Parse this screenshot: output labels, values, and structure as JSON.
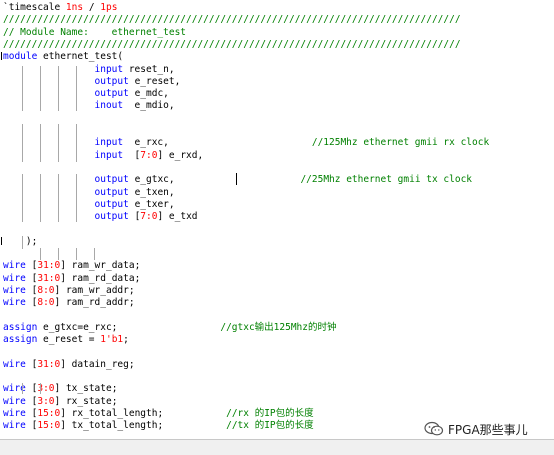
{
  "editor": {
    "lines": [
      [
        {
          "t": "`timescale ",
          "c": "pl"
        },
        {
          "t": "1ns",
          "c": "num"
        },
        {
          "t": " / ",
          "c": "pl"
        },
        {
          "t": "1ps",
          "c": "num"
        }
      ],
      [
        {
          "t": "////////////////////////////////////////////////////////////////////////////////",
          "c": "cm"
        }
      ],
      [
        {
          "t": "// Module Name:    ethernet_test",
          "c": "cm"
        }
      ],
      [
        {
          "t": "////////////////////////////////////////////////////////////////////////////////",
          "c": "cm"
        }
      ],
      [
        {
          "t": "module",
          "c": "kw"
        },
        {
          "t": " ethernet_test(",
          "c": "pl"
        }
      ],
      [
        {
          "t": "                input",
          "c": "kw"
        },
        {
          "t": " reset_n,",
          "c": "pl"
        }
      ],
      [
        {
          "t": "                output",
          "c": "kw"
        },
        {
          "t": " e_reset,",
          "c": "pl"
        }
      ],
      [
        {
          "t": "                output",
          "c": "kw"
        },
        {
          "t": " e_mdc,",
          "c": "pl"
        }
      ],
      [
        {
          "t": "                inout",
          "c": "kw"
        },
        {
          "t": "  e_mdio,",
          "c": "pl"
        }
      ],
      [],
      [],
      [
        {
          "t": "                input",
          "c": "kw"
        },
        {
          "t": "  e_rxc,                         ",
          "c": "pl"
        },
        {
          "t": "//125Mhz ethernet gmii rx clock",
          "c": "cm"
        }
      ],
      [
        {
          "t": "                input",
          "c": "kw"
        },
        {
          "t": "  [",
          "c": "pl"
        },
        {
          "t": "7:0",
          "c": "num"
        },
        {
          "t": "] e_rxd,",
          "c": "pl"
        }
      ],
      [],
      [
        {
          "t": "                output",
          "c": "kw"
        },
        {
          "t": " e_gtxc,                      ",
          "c": "pl"
        },
        {
          "t": "//25Mhz ethernet gmii tx clock",
          "c": "cm"
        }
      ],
      [
        {
          "t": "                output",
          "c": "kw"
        },
        {
          "t": " e_txen,",
          "c": "pl"
        }
      ],
      [
        {
          "t": "                output",
          "c": "kw"
        },
        {
          "t": " e_txer,",
          "c": "pl"
        }
      ],
      [
        {
          "t": "                output",
          "c": "kw"
        },
        {
          "t": " [",
          "c": "pl"
        },
        {
          "t": "7:0",
          "c": "num"
        },
        {
          "t": "] e_txd",
          "c": "pl"
        }
      ],
      [],
      [
        {
          "t": "    );",
          "c": "pl"
        }
      ],
      [],
      [
        {
          "t": "wire",
          "c": "kw"
        },
        {
          "t": " [",
          "c": "pl"
        },
        {
          "t": "31:0",
          "c": "num"
        },
        {
          "t": "] ram_wr_data;",
          "c": "pl"
        }
      ],
      [
        {
          "t": "wire",
          "c": "kw"
        },
        {
          "t": " [",
          "c": "pl"
        },
        {
          "t": "31:0",
          "c": "num"
        },
        {
          "t": "] ram_rd_data;",
          "c": "pl"
        }
      ],
      [
        {
          "t": "wire",
          "c": "kw"
        },
        {
          "t": " [",
          "c": "pl"
        },
        {
          "t": "8:0",
          "c": "num"
        },
        {
          "t": "] ram_wr_addr;",
          "c": "pl"
        }
      ],
      [
        {
          "t": "wire",
          "c": "kw"
        },
        {
          "t": " [",
          "c": "pl"
        },
        {
          "t": "8:0",
          "c": "num"
        },
        {
          "t": "] ram_rd_addr;",
          "c": "pl"
        }
      ],
      [],
      [
        {
          "t": "assign",
          "c": "kw"
        },
        {
          "t": " e_gtxc=e_rxc;                  ",
          "c": "pl"
        },
        {
          "t": "//gtxc输出125Mhz的时钟",
          "c": "cm"
        }
      ],
      [
        {
          "t": "assign",
          "c": "kw"
        },
        {
          "t": " e_reset = ",
          "c": "pl"
        },
        {
          "t": "1'b1",
          "c": "num"
        },
        {
          "t": ";",
          "c": "pl"
        }
      ],
      [],
      [
        {
          "t": "wire",
          "c": "kw"
        },
        {
          "t": " [",
          "c": "pl"
        },
        {
          "t": "31:0",
          "c": "num"
        },
        {
          "t": "] datain_reg;",
          "c": "pl"
        }
      ],
      [],
      [
        {
          "t": "wire",
          "c": "kw"
        },
        {
          "t": " [",
          "c": "pl"
        },
        {
          "t": "3:0",
          "c": "num"
        },
        {
          "t": "] tx_state;",
          "c": "pl"
        }
      ],
      [
        {
          "t": "wire",
          "c": "kw"
        },
        {
          "t": " [",
          "c": "pl"
        },
        {
          "t": "3:0",
          "c": "num"
        },
        {
          "t": "] rx_state;",
          "c": "pl"
        }
      ],
      [
        {
          "t": "wire",
          "c": "kw"
        },
        {
          "t": " [",
          "c": "pl"
        },
        {
          "t": "15:0",
          "c": "num"
        },
        {
          "t": "] rx_total_length;           ",
          "c": "pl"
        },
        {
          "t": "//rx 的IP包的长度",
          "c": "cm"
        }
      ],
      [
        {
          "t": "wire",
          "c": "kw"
        },
        {
          "t": " [",
          "c": "pl"
        },
        {
          "t": "15:0",
          "c": "num"
        },
        {
          "t": "] tx_total_length;           ",
          "c": "pl"
        },
        {
          "t": "//tx 的IP包的长度",
          "c": "cm"
        }
      ]
    ]
  },
  "watermark": {
    "text": "FPGA那些事儿",
    "icon": "wechat-icon"
  },
  "colors": {
    "keyword": "#0000ff",
    "comment": "#008000",
    "number": "#ff0000",
    "text": "#000000"
  }
}
